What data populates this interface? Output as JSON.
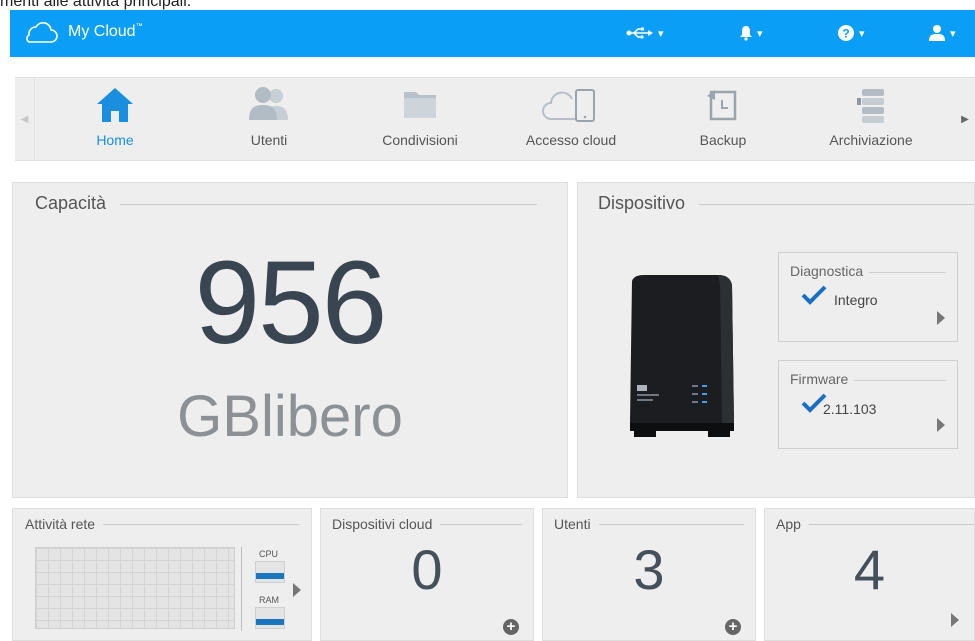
{
  "page_caption": "menti alle attività principali.",
  "app": {
    "title": "My Cloud",
    "title_mark": "™"
  },
  "toolbar": {
    "usb": {
      "icon": "usb-icon",
      "caret": "▾"
    },
    "alerts": {
      "icon": "bell-icon",
      "caret": "▾"
    },
    "help": {
      "icon": "help-icon",
      "caret": "▾"
    },
    "user": {
      "icon": "user-icon",
      "caret": "▾"
    }
  },
  "nav": {
    "items": [
      {
        "label": "Home",
        "icon": "home-icon",
        "active": true
      },
      {
        "label": "Utenti",
        "icon": "users-icon"
      },
      {
        "label": "Condivisioni",
        "icon": "folder-icon"
      },
      {
        "label": "Accesso cloud",
        "icon": "cloud-device-icon"
      },
      {
        "label": "Backup",
        "icon": "backup-icon"
      },
      {
        "label": "Archiviazione",
        "icon": "storage-icon"
      }
    ]
  },
  "capacity": {
    "title": "Capacità",
    "value": "956",
    "unit": "GBlibero"
  },
  "device": {
    "title": "Dispositivo",
    "diagnostics": {
      "title": "Diagnostica",
      "value": "Integro"
    },
    "firmware": {
      "title": "Firmware",
      "value": "2.11.103"
    }
  },
  "network": {
    "title": "Attività rete",
    "cpu_label": "CPU",
    "ram_label": "RAM"
  },
  "cloud_devices": {
    "title": "Dispositivi cloud",
    "count": "0"
  },
  "users": {
    "title": "Utenti",
    "count": "3"
  },
  "apps": {
    "title": "App",
    "count": "4"
  },
  "colors": {
    "accent": "#0a9ef7",
    "active_nav": "#1a8fe0",
    "meter_fill": "#1a76bf"
  }
}
